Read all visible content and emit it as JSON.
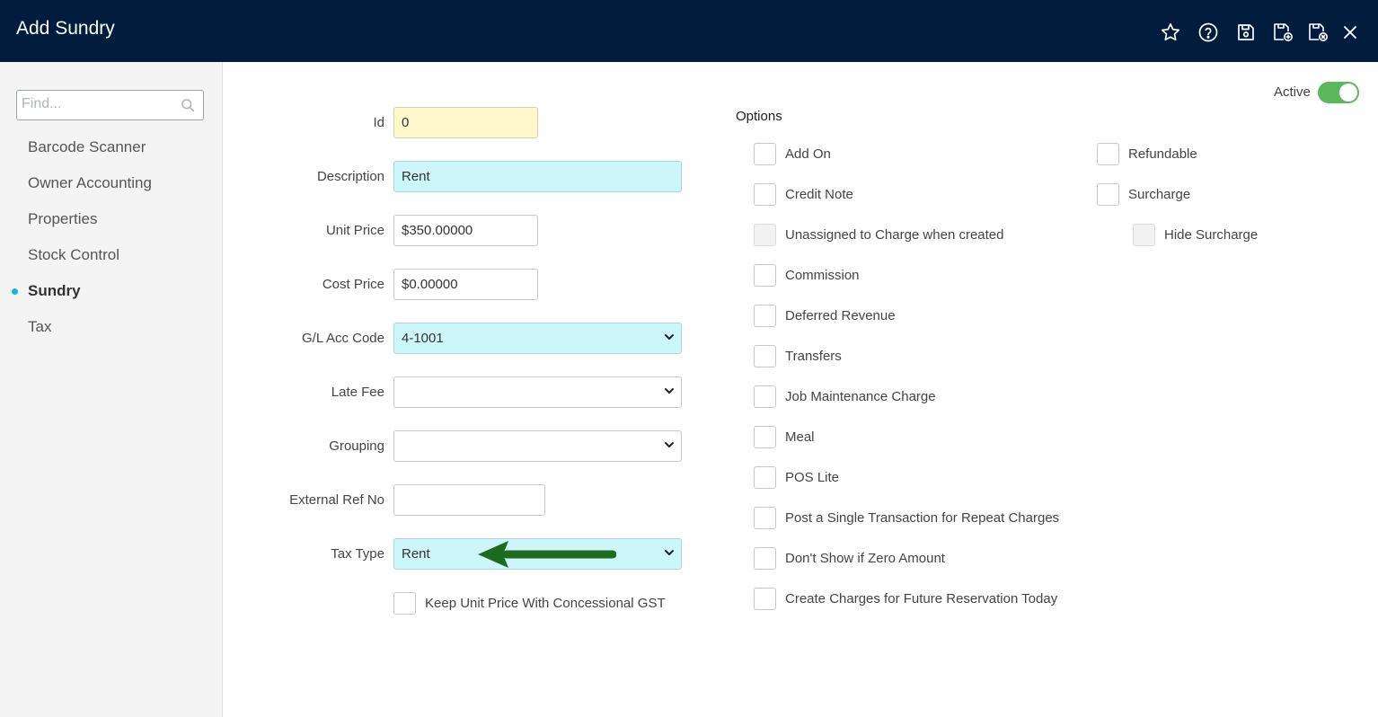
{
  "header": {
    "title": "Add Sundry",
    "icons": [
      "star-icon",
      "help-icon",
      "save-icon",
      "save-and-new-icon",
      "save-and-close-icon",
      "close-icon"
    ]
  },
  "sidebar": {
    "search_placeholder": "Find...",
    "items": [
      {
        "label": "Barcode Scanner"
      },
      {
        "label": "Owner Accounting"
      },
      {
        "label": "Properties"
      },
      {
        "label": "Stock Control"
      },
      {
        "label": "Sundry",
        "active": true
      },
      {
        "label": "Tax"
      }
    ]
  },
  "form": {
    "id": {
      "label": "Id",
      "value": "0"
    },
    "description": {
      "label": "Description",
      "value": "Rent"
    },
    "unit_price": {
      "label": "Unit Price",
      "value": "$350.00000"
    },
    "cost_price": {
      "label": "Cost Price",
      "value": "$0.00000"
    },
    "gl_acc_code": {
      "label": "G/L Acc Code",
      "value": "4-1001"
    },
    "late_fee": {
      "label": "Late Fee",
      "value": ""
    },
    "grouping": {
      "label": "Grouping",
      "value": ""
    },
    "external_ref_no": {
      "label": "External Ref No",
      "value": ""
    },
    "tax_type": {
      "label": "Tax Type",
      "value": "Rent"
    },
    "keep_unit_price": {
      "label": "Keep Unit Price With Concessional GST",
      "checked": false
    }
  },
  "status": {
    "active_label": "Active",
    "active": true
  },
  "options": {
    "title": "Options",
    "left": [
      {
        "label": "Add On",
        "checked": false,
        "disabled": false
      },
      {
        "label": "Credit Note",
        "checked": false,
        "disabled": false
      },
      {
        "label": "Unassigned to Charge when created",
        "checked": false,
        "disabled": true
      },
      {
        "label": "Commission",
        "checked": false,
        "disabled": false
      },
      {
        "label": "Deferred Revenue",
        "checked": false,
        "disabled": false
      },
      {
        "label": "Transfers",
        "checked": false,
        "disabled": false
      },
      {
        "label": "Job Maintenance Charge",
        "checked": false,
        "disabled": false
      },
      {
        "label": "Meal",
        "checked": false,
        "disabled": false
      },
      {
        "label": "POS Lite",
        "checked": false,
        "disabled": false
      },
      {
        "label": "Post a Single Transaction for Repeat Charges",
        "checked": false,
        "disabled": false
      },
      {
        "label": "Don't Show if Zero Amount",
        "checked": false,
        "disabled": false
      },
      {
        "label": "Create Charges for Future Reservation Today",
        "checked": false,
        "disabled": false
      }
    ],
    "right": [
      {
        "label": "Refundable",
        "checked": false,
        "disabled": false
      },
      {
        "label": "Surcharge",
        "checked": false,
        "disabled": false
      },
      {
        "label": "Hide Surcharge",
        "checked": false,
        "disabled": true
      }
    ]
  },
  "colors": {
    "header_bg": "#021c3e",
    "accent": "#0fb9d8",
    "toggle_on": "#5cb85c",
    "arrow": "#1e6b1e",
    "required_field": "#cdf6fb",
    "readonly_field": "#fff8cc"
  }
}
